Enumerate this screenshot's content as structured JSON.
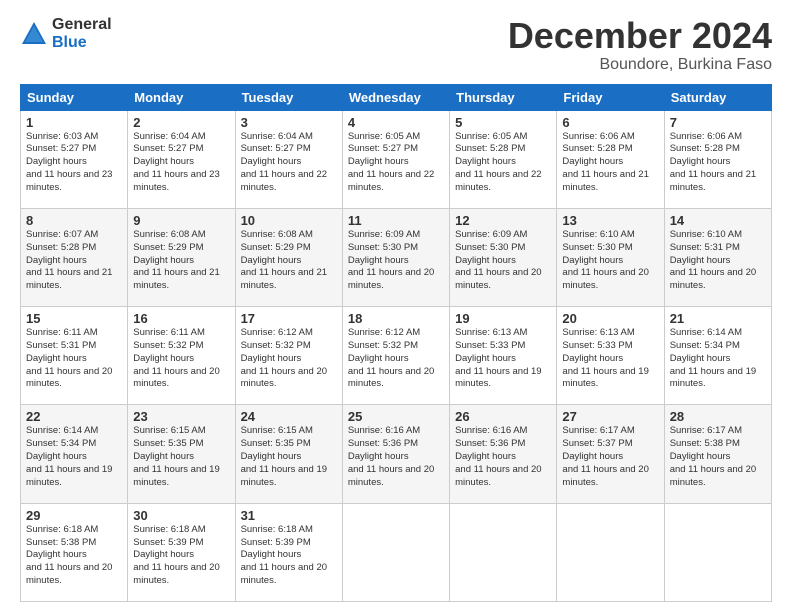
{
  "header": {
    "logo_general": "General",
    "logo_blue": "Blue",
    "month": "December 2024",
    "location": "Boundore, Burkina Faso"
  },
  "weekdays": [
    "Sunday",
    "Monday",
    "Tuesday",
    "Wednesday",
    "Thursday",
    "Friday",
    "Saturday"
  ],
  "weeks": [
    [
      {
        "day": "1",
        "sunrise": "6:03 AM",
        "sunset": "5:27 PM",
        "daylight": "11 hours and 23 minutes."
      },
      {
        "day": "2",
        "sunrise": "6:04 AM",
        "sunset": "5:27 PM",
        "daylight": "11 hours and 23 minutes."
      },
      {
        "day": "3",
        "sunrise": "6:04 AM",
        "sunset": "5:27 PM",
        "daylight": "11 hours and 22 minutes."
      },
      {
        "day": "4",
        "sunrise": "6:05 AM",
        "sunset": "5:27 PM",
        "daylight": "11 hours and 22 minutes."
      },
      {
        "day": "5",
        "sunrise": "6:05 AM",
        "sunset": "5:28 PM",
        "daylight": "11 hours and 22 minutes."
      },
      {
        "day": "6",
        "sunrise": "6:06 AM",
        "sunset": "5:28 PM",
        "daylight": "11 hours and 21 minutes."
      },
      {
        "day": "7",
        "sunrise": "6:06 AM",
        "sunset": "5:28 PM",
        "daylight": "11 hours and 21 minutes."
      }
    ],
    [
      {
        "day": "8",
        "sunrise": "6:07 AM",
        "sunset": "5:28 PM",
        "daylight": "11 hours and 21 minutes."
      },
      {
        "day": "9",
        "sunrise": "6:08 AM",
        "sunset": "5:29 PM",
        "daylight": "11 hours and 21 minutes."
      },
      {
        "day": "10",
        "sunrise": "6:08 AM",
        "sunset": "5:29 PM",
        "daylight": "11 hours and 21 minutes."
      },
      {
        "day": "11",
        "sunrise": "6:09 AM",
        "sunset": "5:30 PM",
        "daylight": "11 hours and 20 minutes."
      },
      {
        "day": "12",
        "sunrise": "6:09 AM",
        "sunset": "5:30 PM",
        "daylight": "11 hours and 20 minutes."
      },
      {
        "day": "13",
        "sunrise": "6:10 AM",
        "sunset": "5:30 PM",
        "daylight": "11 hours and 20 minutes."
      },
      {
        "day": "14",
        "sunrise": "6:10 AM",
        "sunset": "5:31 PM",
        "daylight": "11 hours and 20 minutes."
      }
    ],
    [
      {
        "day": "15",
        "sunrise": "6:11 AM",
        "sunset": "5:31 PM",
        "daylight": "11 hours and 20 minutes."
      },
      {
        "day": "16",
        "sunrise": "6:11 AM",
        "sunset": "5:32 PM",
        "daylight": "11 hours and 20 minutes."
      },
      {
        "day": "17",
        "sunrise": "6:12 AM",
        "sunset": "5:32 PM",
        "daylight": "11 hours and 20 minutes."
      },
      {
        "day": "18",
        "sunrise": "6:12 AM",
        "sunset": "5:32 PM",
        "daylight": "11 hours and 20 minutes."
      },
      {
        "day": "19",
        "sunrise": "6:13 AM",
        "sunset": "5:33 PM",
        "daylight": "11 hours and 19 minutes."
      },
      {
        "day": "20",
        "sunrise": "6:13 AM",
        "sunset": "5:33 PM",
        "daylight": "11 hours and 19 minutes."
      },
      {
        "day": "21",
        "sunrise": "6:14 AM",
        "sunset": "5:34 PM",
        "daylight": "11 hours and 19 minutes."
      }
    ],
    [
      {
        "day": "22",
        "sunrise": "6:14 AM",
        "sunset": "5:34 PM",
        "daylight": "11 hours and 19 minutes."
      },
      {
        "day": "23",
        "sunrise": "6:15 AM",
        "sunset": "5:35 PM",
        "daylight": "11 hours and 19 minutes."
      },
      {
        "day": "24",
        "sunrise": "6:15 AM",
        "sunset": "5:35 PM",
        "daylight": "11 hours and 19 minutes."
      },
      {
        "day": "25",
        "sunrise": "6:16 AM",
        "sunset": "5:36 PM",
        "daylight": "11 hours and 20 minutes."
      },
      {
        "day": "26",
        "sunrise": "6:16 AM",
        "sunset": "5:36 PM",
        "daylight": "11 hours and 20 minutes."
      },
      {
        "day": "27",
        "sunrise": "6:17 AM",
        "sunset": "5:37 PM",
        "daylight": "11 hours and 20 minutes."
      },
      {
        "day": "28",
        "sunrise": "6:17 AM",
        "sunset": "5:38 PM",
        "daylight": "11 hours and 20 minutes."
      }
    ],
    [
      {
        "day": "29",
        "sunrise": "6:18 AM",
        "sunset": "5:38 PM",
        "daylight": "11 hours and 20 minutes."
      },
      {
        "day": "30",
        "sunrise": "6:18 AM",
        "sunset": "5:39 PM",
        "daylight": "11 hours and 20 minutes."
      },
      {
        "day": "31",
        "sunrise": "6:18 AM",
        "sunset": "5:39 PM",
        "daylight": "11 hours and 20 minutes."
      },
      null,
      null,
      null,
      null
    ]
  ]
}
